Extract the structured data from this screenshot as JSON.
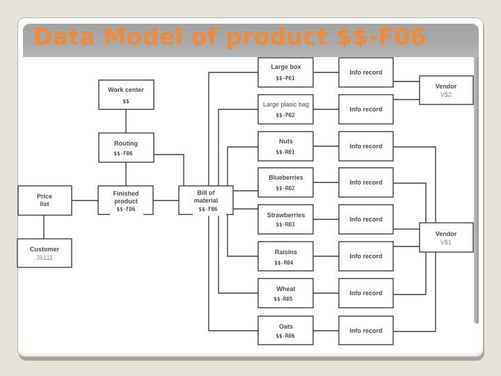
{
  "slide": {
    "title": "Data Model of product $$-F06"
  },
  "diagram": {
    "work_center": {
      "label": "Work center",
      "code": "$$"
    },
    "routing": {
      "label": "Routing",
      "code": "$$-F06"
    },
    "price_list": {
      "line1": "Price",
      "line2": "list"
    },
    "customer": {
      "label": "Customer",
      "number": "35111"
    },
    "finished_product": {
      "line1": "Finished",
      "line2": "product",
      "code": "$$-F06"
    },
    "bill_of_material": {
      "line1": "Bill of",
      "line2": "material",
      "code": "$$-F06"
    },
    "materials": [
      {
        "label": "Large box",
        "code": "$$-P01"
      },
      {
        "label": "Large plasic bag",
        "code": "$$-P02"
      },
      {
        "label": "Nuts",
        "code": "$$-R01"
      },
      {
        "label": "Blueberries",
        "code": "$$-R02"
      },
      {
        "label": "Strawberries",
        "code": "$$-R03"
      },
      {
        "label": "Raisins",
        "code": "$$-R04"
      },
      {
        "label": "Wheat",
        "code": "$$-R05"
      },
      {
        "label": "Oats",
        "code": "$$-R06"
      }
    ],
    "info_records": [
      {
        "label": "Info record"
      },
      {
        "label": "Info record"
      },
      {
        "label": "Info record"
      },
      {
        "label": "Info record"
      },
      {
        "label": "Info record"
      },
      {
        "label": "Info record"
      },
      {
        "label": "Info record"
      },
      {
        "label": "Info record"
      }
    ],
    "vendors": [
      {
        "label": "Vendor",
        "id": "V$2"
      },
      {
        "label": "Vendor",
        "id": "V$1"
      }
    ]
  },
  "colors": {
    "title": "#f28b38",
    "title_band": "#a8a8a8",
    "background": "#e6e2d9",
    "line": "#3e3e3e"
  }
}
